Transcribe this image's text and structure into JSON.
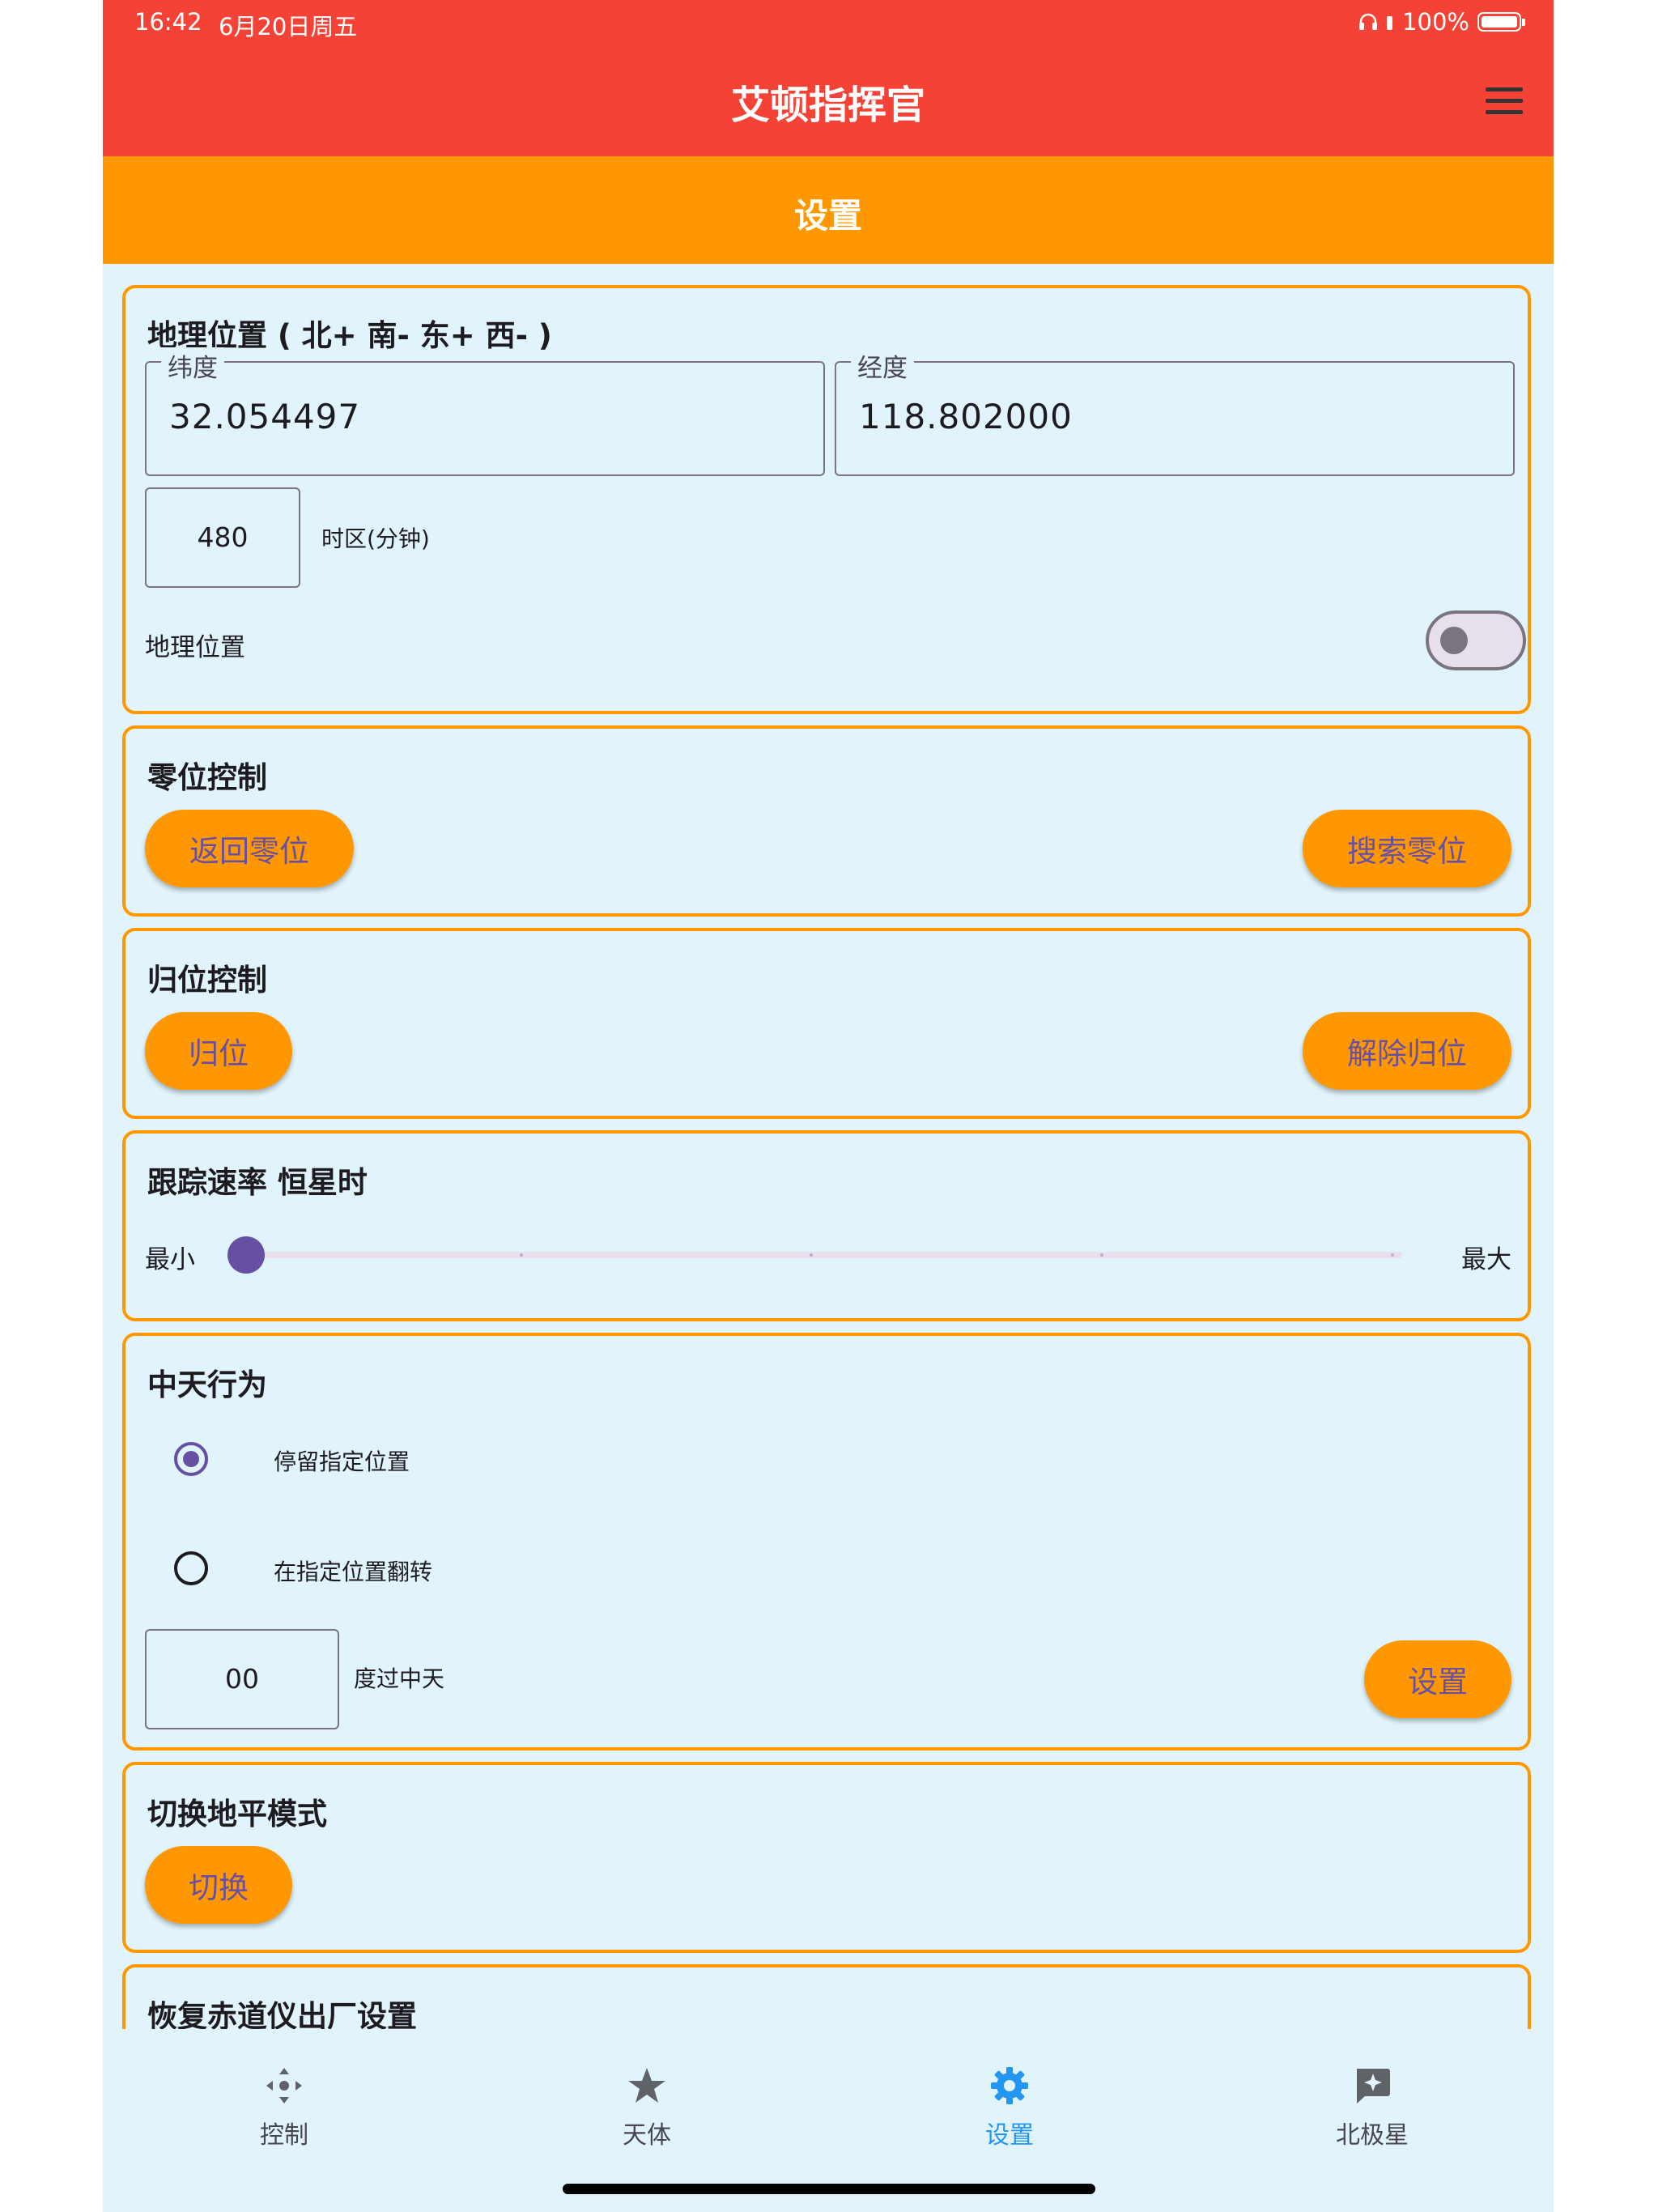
{
  "status_bar": {
    "time": "16:42",
    "date": "6月20日周五",
    "battery": "100%"
  },
  "app_bar": {
    "title": "艾顿指挥官"
  },
  "sub_bar": {
    "title": "设置"
  },
  "colors": {
    "primary": "#f44336",
    "accent": "#ff9800",
    "background": "#e1f4fb",
    "control": "#6750a4",
    "nav_active": "#2196f3"
  },
  "geo": {
    "title": "地理位置 ( 北+ 南- 东+ 西- )",
    "lat_label": "纬度",
    "lat_value": "32.054497",
    "lon_label": "经度",
    "lon_value": "118.802000",
    "tz_value": "480",
    "tz_label": "时区(分钟)",
    "toggle_label": "地理位置",
    "toggle_on": false
  },
  "zero": {
    "title": "零位控制",
    "btn_return": "返回零位",
    "btn_search": "搜索零位"
  },
  "home": {
    "title": "归位控制",
    "btn_home": "归位",
    "btn_release": "解除归位"
  },
  "tracking": {
    "title": "跟踪速率 恒星时",
    "min_label": "最小",
    "max_label": "最大",
    "value": 0
  },
  "meridian": {
    "title": "中天行为",
    "option1": "停留指定位置",
    "option2": "在指定位置翻转",
    "selected": 0,
    "degrees_value": "00",
    "degrees_label": "度过中天",
    "btn_set": "设置"
  },
  "horizon": {
    "title": "切换地平模式",
    "btn_switch": "切换"
  },
  "factory": {
    "title": "恢复赤道仪出厂设置"
  },
  "nav": [
    {
      "label": "控制",
      "icon": "control-icon"
    },
    {
      "label": "天体",
      "icon": "star-icon"
    },
    {
      "label": "设置",
      "icon": "gear-icon",
      "active": true
    },
    {
      "label": "北极星",
      "icon": "polaris-icon"
    }
  ]
}
